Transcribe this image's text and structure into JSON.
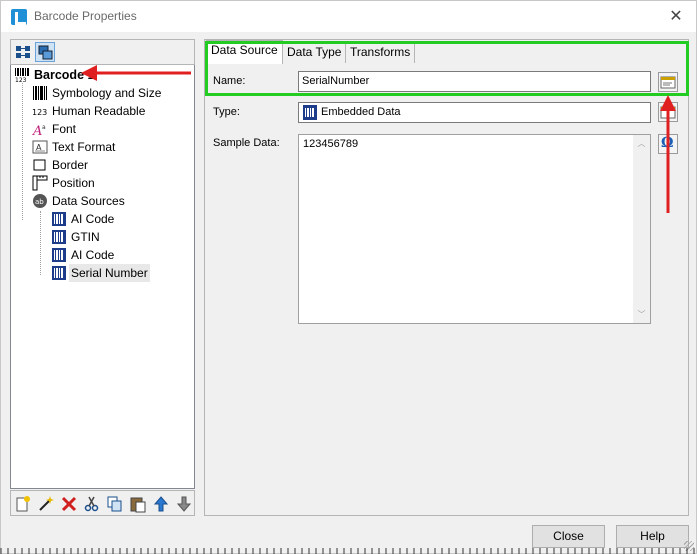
{
  "window": {
    "title": "Barcode Properties",
    "close_glyph": "✕"
  },
  "tree": {
    "root": {
      "label": "Barcode 1",
      "icon": "barcode-icon"
    },
    "items": [
      {
        "label": "Symbology and Size",
        "icon": "barcode-lines-icon"
      },
      {
        "label": "Human Readable",
        "icon": "numbers-123-icon"
      },
      {
        "label": "Font",
        "icon": "font-icon"
      },
      {
        "label": "Text Format",
        "icon": "text-format-icon"
      },
      {
        "label": "Border",
        "icon": "border-square-icon"
      },
      {
        "label": "Position",
        "icon": "ruler-icon"
      },
      {
        "label": "Data Sources",
        "icon": "data-sources-icon"
      }
    ],
    "sources": [
      {
        "label": "AI Code",
        "icon": "data-source-icon"
      },
      {
        "label": "GTIN",
        "icon": "data-source-icon"
      },
      {
        "label": "AI Code",
        "icon": "data-source-icon"
      },
      {
        "label": "Serial Number",
        "icon": "data-source-icon"
      }
    ]
  },
  "tabs": [
    "Data Source",
    "Data Type",
    "Transforms"
  ],
  "form": {
    "name_label": "Name:",
    "name_value": "SerialNumber",
    "type_label": "Type:",
    "type_value": "Embedded Data",
    "sample_label": "Sample Data:",
    "sample_value": "123456789"
  },
  "buttons": {
    "close": "Close",
    "help": "Help"
  },
  "colors": {
    "highlight_box": "#22cc22",
    "arrow": "#e02020",
    "accent": "#1f8fd6"
  }
}
